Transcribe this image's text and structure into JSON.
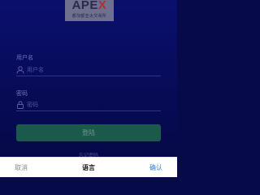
{
  "logo": {
    "text_main": "APE",
    "text_accent": "X",
    "subtitle": "都加都亚太交易所"
  },
  "form": {
    "username_label": "用户名",
    "username_placeholder": "用户名",
    "password_label": "密码",
    "password_placeholder": "密码",
    "login_button": "登陆",
    "forgot_link": "忘记密码"
  },
  "picker": {
    "cancel": "取消",
    "title": "语言",
    "confirm": "确认"
  },
  "colors": {
    "background": "#0a0f6e",
    "login_button": "#1b5a4a",
    "confirm_text": "#2f7fe0"
  },
  "icons": {
    "user": "user-icon",
    "lock": "lock-icon"
  }
}
